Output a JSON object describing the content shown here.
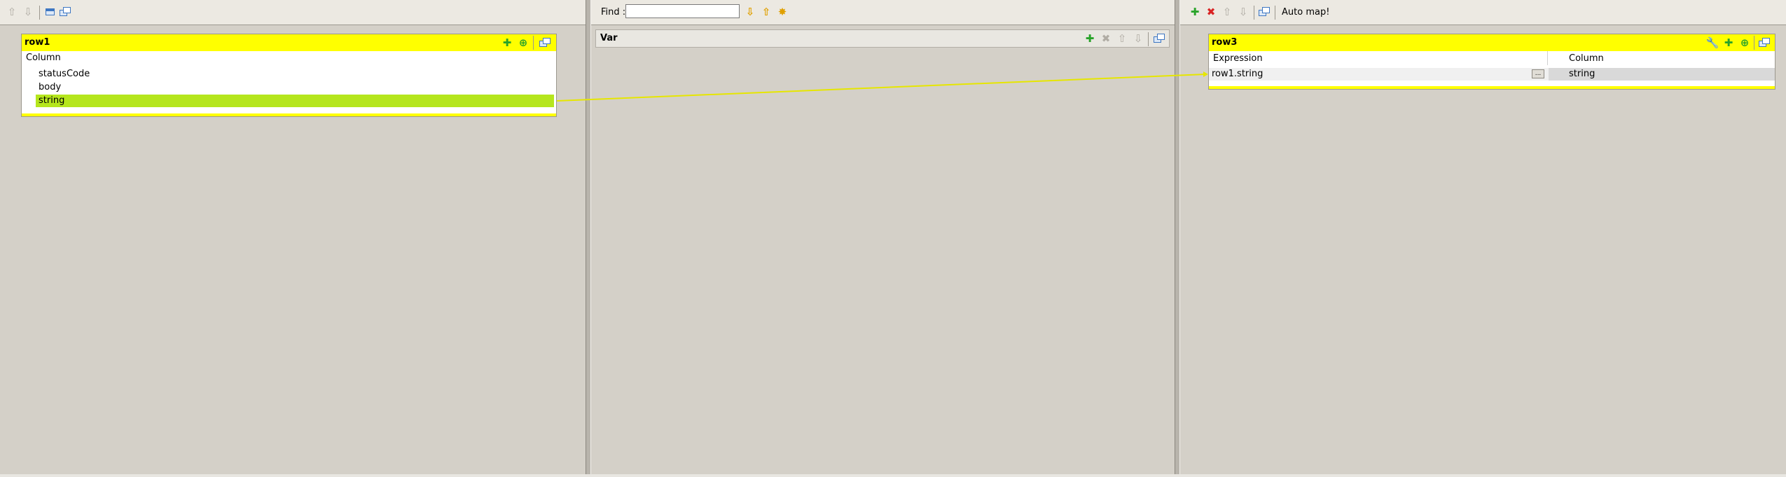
{
  "left": {
    "toolbar": {
      "icons": [
        "move-up-icon",
        "move-down-icon",
        "minimize-icon",
        "window-icon"
      ]
    },
    "input_table": {
      "title": "row1",
      "column_header": "Column",
      "rows": [
        "statusCode",
        "body",
        "string"
      ],
      "selected_row": "string",
      "highlight_color": "#b5e61d"
    }
  },
  "middle": {
    "find": {
      "label": "Find :",
      "value": ""
    },
    "var": {
      "title": "Var"
    }
  },
  "right": {
    "toolbar": {
      "auto_map_label": "Auto map!"
    },
    "output_table": {
      "title": "row3",
      "headers": {
        "expression": "Expression",
        "column": "Column"
      },
      "rows": [
        {
          "expression": "row1.string",
          "button": "...",
          "column": "string"
        }
      ]
    }
  },
  "colors": {
    "title_bar": "#ffff00",
    "link_line": "#e6e600",
    "background": "#d4d0c8"
  }
}
